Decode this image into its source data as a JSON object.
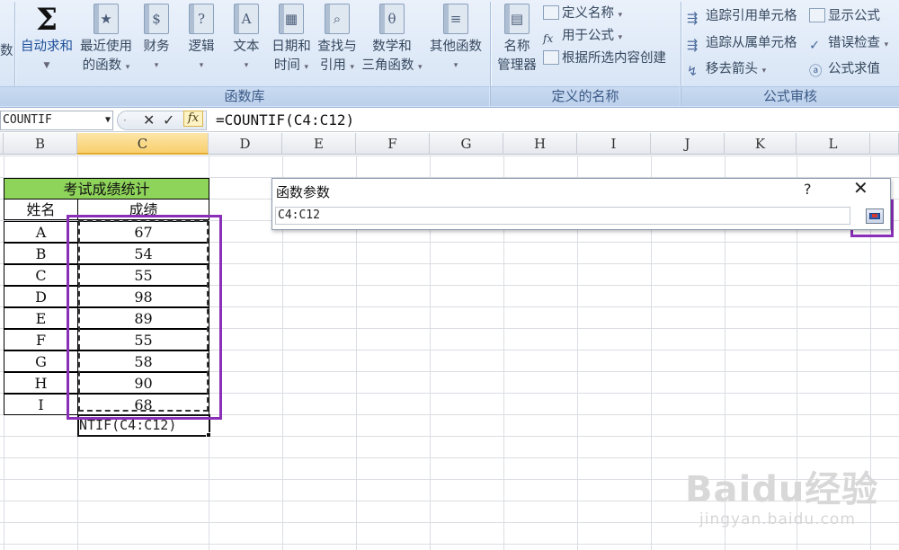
{
  "ribbon": {
    "cut_item_label": "数",
    "buttons": [
      {
        "label1": "自动求和",
        "label2": "",
        "icon": "sigma-icon"
      },
      {
        "label1": "最近使用",
        "label2": "的函数",
        "icon": "recent-functions-icon"
      },
      {
        "label1": "财务",
        "label2": "",
        "icon": "financial-icon"
      },
      {
        "label1": "逻辑",
        "label2": "",
        "icon": "logical-icon",
        "glyph": "?"
      },
      {
        "label1": "文本",
        "label2": "",
        "icon": "text-icon",
        "glyph": "A"
      },
      {
        "label1": "日期和",
        "label2": "时间",
        "icon": "date-time-icon"
      },
      {
        "label1": "查找与",
        "label2": "引用",
        "icon": "lookup-icon"
      },
      {
        "label1": "数学和",
        "label2": "三角函数",
        "icon": "math-trig-icon",
        "glyph": "θ"
      },
      {
        "label1": "其他函数",
        "label2": "",
        "icon": "more-functions-icon"
      }
    ],
    "group_library": "函数库",
    "name_manager": {
      "label1": "名称",
      "label2": "管理器"
    },
    "define_name": "定义名称",
    "use_in_formula": "用于公式",
    "create_from_selection": "根据所选内容创建",
    "group_defined_names": "定义的名称",
    "trace_precedents": "追踪引用单元格",
    "trace_dependents": "追踪从属单元格",
    "remove_arrows": "移去箭头",
    "show_formulas": "显示公式",
    "error_checking": "错误检查",
    "evaluate_formula": "公式求值",
    "group_auditing": "公式审核"
  },
  "formula_bar": {
    "name_box": "COUNTIF",
    "formula": "=COUNTIF(C4:C12)",
    "fx": "fx"
  },
  "columns": [
    "B",
    "C",
    "D",
    "E",
    "F",
    "G",
    "H",
    "I",
    "J",
    "K",
    "L"
  ],
  "table": {
    "title": "考试成绩统计",
    "header_name": "姓名",
    "header_score": "成绩",
    "rows": [
      {
        "name": "A",
        "score": "67"
      },
      {
        "name": "B",
        "score": "54"
      },
      {
        "name": "C",
        "score": "55"
      },
      {
        "name": "D",
        "score": "98"
      },
      {
        "name": "E",
        "score": "89"
      },
      {
        "name": "F",
        "score": "55"
      },
      {
        "name": "G",
        "score": "58"
      },
      {
        "name": "H",
        "score": "90"
      },
      {
        "name": "I",
        "score": "68"
      }
    ],
    "editing_cell": "NTIF(C4:C12)"
  },
  "dialog": {
    "title": "函数参数",
    "help": "?",
    "close": "✕",
    "input_value": "C4:C12"
  },
  "watermark": {
    "line1": "Baidu经验",
    "line2": "jingyan.baidu.com"
  },
  "colors": {
    "title_fill": "#8ed35a",
    "highlight": "#8a2fb8",
    "selected_col": "#f8cf6e"
  }
}
